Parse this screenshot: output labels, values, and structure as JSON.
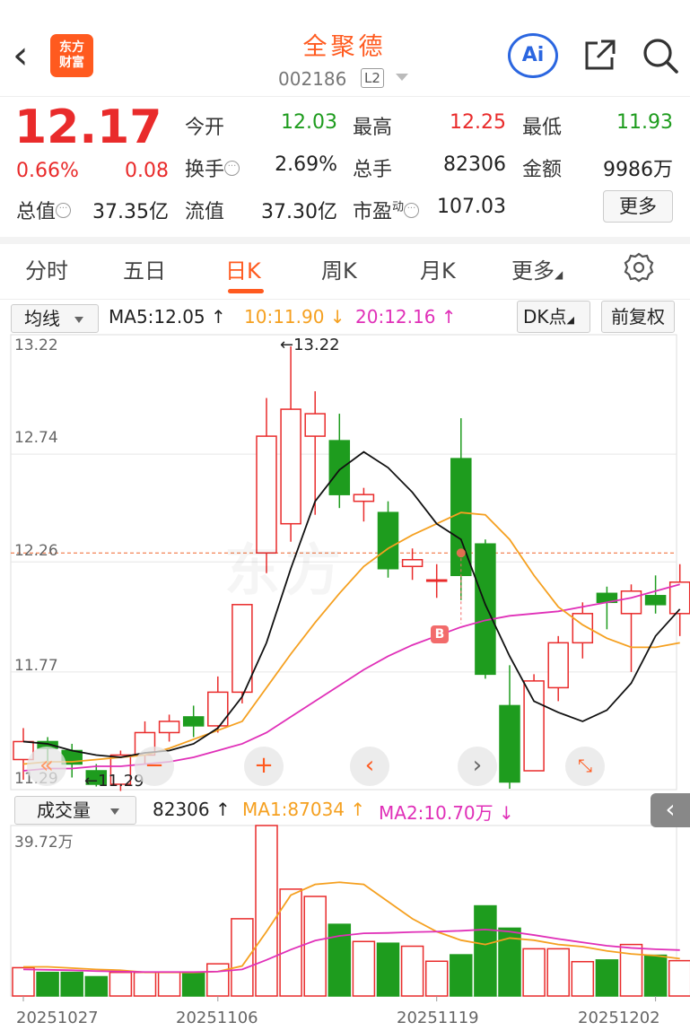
{
  "header": {
    "back_icon": "chevron-left-icon",
    "logo_line1": "东方",
    "logo_line2": "财富",
    "title": "全聚德",
    "code": "002186",
    "level": "L2",
    "ai_label": "Ai"
  },
  "quote": {
    "price": "12.17",
    "change_pct": "0.66%",
    "change": "0.08",
    "open_label": "今开",
    "open": "12.03",
    "high_label": "最高",
    "high": "12.25",
    "low_label": "最低",
    "low": "11.93",
    "turnover_label": "换手",
    "turnover": "2.69%",
    "volume_label": "总手",
    "volume": "82306",
    "amount_label": "金额",
    "amount": "9986万",
    "mktcap_label": "总值",
    "mktcap": "37.35亿",
    "float_label": "流值",
    "float_cap": "37.30亿",
    "pe_label": "市盈",
    "pe_sup": "动",
    "pe": "107.03",
    "more_button": "更多"
  },
  "tabs": [
    "分时",
    "五日",
    "日K",
    "周K",
    "月K",
    "更多"
  ],
  "indicators": {
    "ma_select": "均线",
    "ma5": "MA5:12.05 ↑",
    "ma10": "10:11.90 ↓",
    "ma20": "20:12.16 ↑",
    "dk_button": "DK点",
    "adjust_button": "前复权",
    "vol_select": "成交量",
    "vol_value": "82306 ↑",
    "vol_ma1": "MA1:87034 ↑",
    "vol_ma2": "MA2:10.70万 ↓"
  },
  "colors": {
    "up": "#e92b2b",
    "down": "#1e9c1e",
    "accent": "#ff5a1f",
    "ma5": "#111111",
    "ma10": "#f5a020",
    "ma20": "#e030b8"
  },
  "chart_data": {
    "type": "candlestick",
    "price_axis_labels": [
      "13.22",
      "12.74",
      "12.26",
      "11.77",
      "11.29"
    ],
    "price_range": [
      11.29,
      13.22
    ],
    "max_marker": "←13.22",
    "min_marker": "←11.29",
    "buy_marker": "B",
    "candles": [
      {
        "o": 11.38,
        "c": 11.46,
        "h": 11.52,
        "l": 11.29
      },
      {
        "o": 11.46,
        "c": 11.43,
        "h": 11.48,
        "l": 11.35
      },
      {
        "o": 11.42,
        "c": 11.36,
        "h": 11.45,
        "l": 11.3
      },
      {
        "o": 11.33,
        "c": 11.27,
        "h": 11.36,
        "l": 11.26
      },
      {
        "o": 11.27,
        "c": 11.4,
        "h": 11.42,
        "l": 11.24
      },
      {
        "o": 11.4,
        "c": 11.5,
        "h": 11.55,
        "l": 11.36
      },
      {
        "o": 11.5,
        "c": 11.55,
        "h": 11.58,
        "l": 11.46
      },
      {
        "o": 11.57,
        "c": 11.53,
        "h": 11.62,
        "l": 11.48
      },
      {
        "o": 11.53,
        "c": 11.68,
        "h": 11.75,
        "l": 11.5
      },
      {
        "o": 11.68,
        "c": 12.07,
        "h": 12.07,
        "l": 11.63
      },
      {
        "o": 12.3,
        "c": 12.82,
        "h": 12.99,
        "l": 12.21
      },
      {
        "o": 12.43,
        "c": 12.94,
        "h": 13.22,
        "l": 12.35
      },
      {
        "o": 12.82,
        "c": 12.92,
        "h": 13.02,
        "l": 12.47
      },
      {
        "o": 12.8,
        "c": 12.56,
        "h": 12.92,
        "l": 12.5
      },
      {
        "o": 12.53,
        "c": 12.56,
        "h": 12.59,
        "l": 12.44
      },
      {
        "o": 12.48,
        "c": 12.23,
        "h": 12.53,
        "l": 12.19
      },
      {
        "o": 12.24,
        "c": 12.27,
        "h": 12.32,
        "l": 12.18
      },
      {
        "o": 12.18,
        "c": 12.18,
        "h": 12.25,
        "l": 12.1
      },
      {
        "o": 12.72,
        "c": 12.2,
        "h": 12.9,
        "l": 12.09
      },
      {
        "o": 12.34,
        "c": 11.76,
        "h": 12.36,
        "l": 11.74
      },
      {
        "o": 11.62,
        "c": 11.28,
        "h": 11.8,
        "l": 11.25
      },
      {
        "o": 11.33,
        "c": 11.73,
        "h": 11.76,
        "l": 11.33
      },
      {
        "o": 11.7,
        "c": 11.9,
        "h": 11.93,
        "l": 11.64
      },
      {
        "o": 11.9,
        "c": 12.03,
        "h": 12.08,
        "l": 11.83
      },
      {
        "o": 12.12,
        "c": 12.08,
        "h": 12.15,
        "l": 11.96
      },
      {
        "o": 12.03,
        "c": 12.13,
        "h": 12.16,
        "l": 11.77
      },
      {
        "o": 12.11,
        "c": 12.07,
        "h": 12.2,
        "l": 12.03
      },
      {
        "o": 12.03,
        "c": 12.17,
        "h": 12.25,
        "l": 11.93
      }
    ],
    "ma5": [
      11.46,
      11.45,
      11.42,
      11.4,
      11.39,
      11.41,
      11.42,
      11.45,
      11.52,
      11.66,
      11.9,
      12.23,
      12.53,
      12.67,
      12.75,
      12.68,
      12.57,
      12.43,
      12.36,
      12.07,
      11.84,
      11.64,
      11.59,
      11.55,
      11.6,
      11.72,
      11.93,
      12.05
    ],
    "ma10": [
      11.36,
      11.37,
      11.37,
      11.38,
      11.39,
      11.4,
      11.43,
      11.47,
      11.51,
      11.55,
      11.7,
      11.85,
      11.99,
      12.12,
      12.24,
      12.32,
      12.38,
      12.43,
      12.48,
      12.47,
      12.36,
      12.2,
      12.06,
      11.98,
      11.92,
      11.88,
      11.88,
      11.9
    ],
    "ma20": [
      11.33,
      11.34,
      11.34,
      11.35,
      11.35,
      11.36,
      11.37,
      11.39,
      11.42,
      11.45,
      11.5,
      11.57,
      11.64,
      11.71,
      11.78,
      11.84,
      11.89,
      11.93,
      11.97,
      12.0,
      12.02,
      12.03,
      12.04,
      12.06,
      12.08,
      12.1,
      12.13,
      12.16
    ],
    "volume_axis_label": "39.72万",
    "volume_max": 397200,
    "volumes": [
      66000,
      55000,
      55000,
      45000,
      55000,
      55000,
      55000,
      55000,
      75000,
      180000,
      397200,
      249000,
      232000,
      167000,
      127000,
      123000,
      116000,
      81000,
      96000,
      210000,
      158000,
      110000,
      110000,
      80000,
      84000,
      120000,
      95000,
      82306
    ],
    "vol_ma1": [
      68000,
      68000,
      65000,
      62000,
      60000,
      55000,
      55000,
      55000,
      57000,
      70000,
      150000,
      235000,
      260000,
      265000,
      260000,
      220000,
      180000,
      150000,
      130000,
      120000,
      135000,
      130000,
      120000,
      115000,
      105000,
      98000,
      94000,
      87034
    ],
    "vol_ma2": [
      62000,
      61000,
      60000,
      58000,
      57000,
      56000,
      56000,
      56000,
      57000,
      62000,
      84000,
      108000,
      129000,
      140000,
      146000,
      147000,
      149000,
      150000,
      152000,
      155000,
      150000,
      142000,
      133000,
      125000,
      117000,
      112000,
      109000,
      107000
    ],
    "date_labels": [
      "20251027",
      "20251106",
      "20251119",
      "20251202"
    ],
    "date_label_indices": [
      0,
      8,
      17,
      26
    ]
  }
}
